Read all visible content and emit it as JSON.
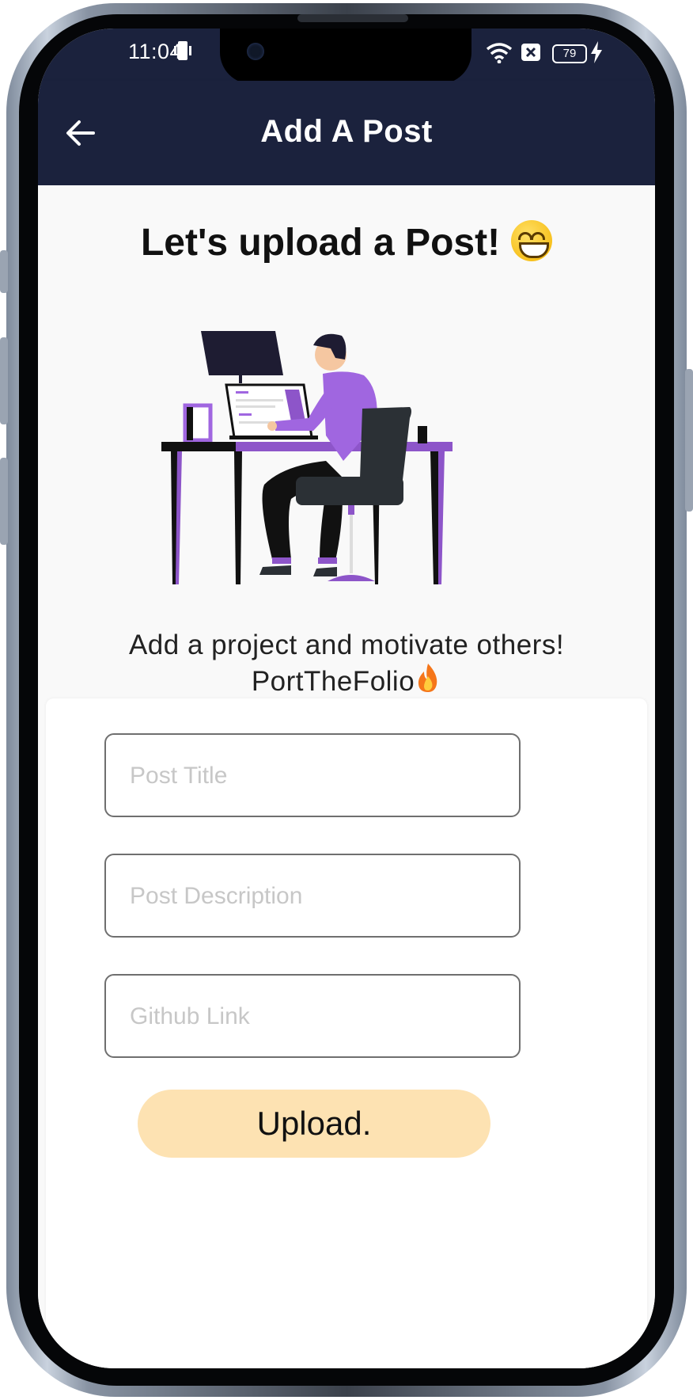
{
  "status_bar": {
    "time": "11:04",
    "battery": "79",
    "icons": [
      "phone-vibrate-icon",
      "wifi-icon",
      "sim-x-icon",
      "charging-icon"
    ]
  },
  "app_bar": {
    "title": "Add A Post",
    "back_icon": "arrow-left-icon"
  },
  "main": {
    "headline": "Let's upload a Post!",
    "headline_emoji": "grinning-face-emoji",
    "subtitle_line1": "Add a project and motivate others!",
    "subtitle_line2": "PortTheFolio",
    "subtitle_emoji": "fire-emoji"
  },
  "form": {
    "title_placeholder": "Post Title",
    "description_placeholder": "Post Description",
    "github_placeholder": "Github Link",
    "upload_label": "Upload."
  },
  "colors": {
    "app_bar": "#1b223d",
    "accent_purple": "#a066e0",
    "button_bg": "#fde2b2"
  }
}
